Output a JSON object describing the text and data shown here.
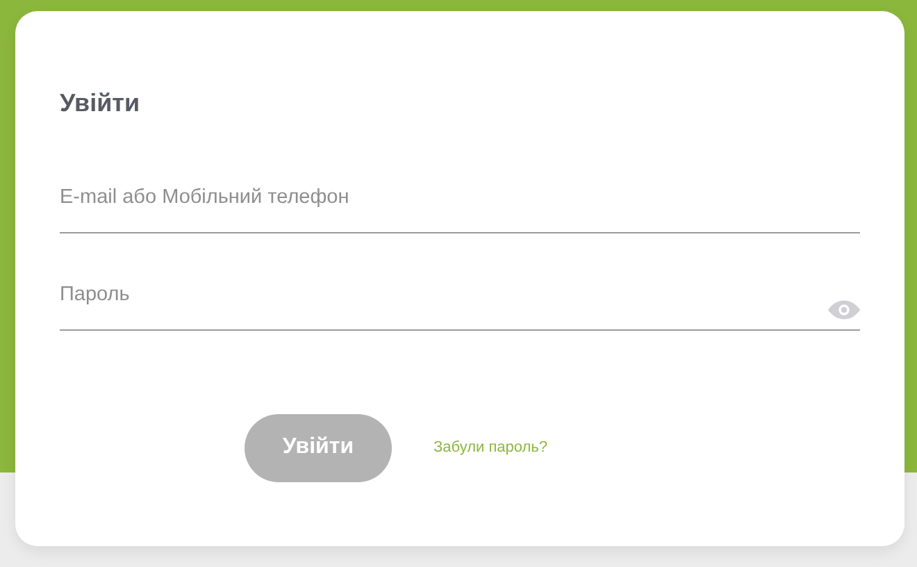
{
  "title": "Увійти",
  "fields": [
    {
      "placeholder": "E-mail або Мобільний телефон",
      "kind": "text"
    },
    {
      "placeholder": "Пароль",
      "kind": "password"
    }
  ],
  "submit": {
    "label": "Увійти",
    "disabled": true
  },
  "forgot_link": "Забули пароль?"
}
